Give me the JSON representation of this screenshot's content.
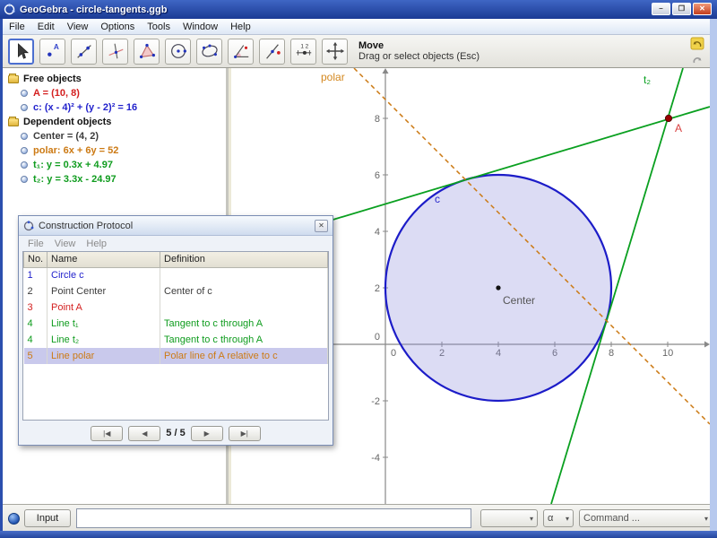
{
  "window": {
    "title": "GeoGebra - circle-tangents.ggb",
    "controls": {
      "minimize": "–",
      "maximize": "❐",
      "close": "✕"
    }
  },
  "menu": {
    "items": [
      "File",
      "Edit",
      "View",
      "Options",
      "Tools",
      "Window",
      "Help"
    ]
  },
  "toolbar": {
    "tools": [
      "move",
      "point",
      "line",
      "perpendicular-line",
      "polygon",
      "circle",
      "conic",
      "angle",
      "mirror",
      "slider",
      "move-graphics-view"
    ],
    "tooltip_title": "Move",
    "tooltip_subtitle": "Drag or select objects (Esc)"
  },
  "algebra": {
    "free_header": "Free objects",
    "dependent_header": "Dependent objects",
    "free": [
      {
        "label": "A = (10, 8)",
        "color": "#d42020"
      },
      {
        "label": "c: (x - 4)² + (y - 2)² = 16",
        "color": "#2222cc"
      }
    ],
    "dependent": [
      {
        "label": "Center = (4, 2)",
        "color": "#3c3c3c"
      },
      {
        "label": "polar: 6x + 6y = 52",
        "color": "#cc7a14"
      },
      {
        "label": "t₁: y = 0.3x + 4.97",
        "color": "#0f9c1e"
      },
      {
        "label": "t₂: y = 3.3x - 24.97",
        "color": "#0f9c1e"
      }
    ]
  },
  "protocol": {
    "title": "Construction Protocol",
    "close": "✕",
    "menu": [
      "File",
      "View",
      "Help"
    ],
    "columns": [
      "No.",
      "Name",
      "Definition"
    ],
    "rows": [
      {
        "no": "1",
        "name": "Circle c",
        "definition": "",
        "color": "#2222cc"
      },
      {
        "no": "2",
        "name": "Point Center",
        "definition": "Center of c",
        "color": "#3c3c3c"
      },
      {
        "no": "3",
        "name": "Point A",
        "definition": "",
        "color": "#d42020"
      },
      {
        "no": "4",
        "name": "Line t₁",
        "definition": "Tangent to c through A",
        "color": "#0f9c1e"
      },
      {
        "no": "4",
        "name": "Line t₂",
        "definition": "Tangent to c through A",
        "color": "#0f9c1e"
      },
      {
        "no": "5",
        "name": "Line polar",
        "definition": "Polar line of A relative to c",
        "color": "#cc7a14",
        "selected": true
      }
    ],
    "nav": {
      "first": "|◀",
      "prev": "◀",
      "position": "5 / 5",
      "next": "▶",
      "last": "▶|"
    }
  },
  "graph": {
    "x_ticks": [
      "0",
      "2",
      "4",
      "6",
      "8",
      "10"
    ],
    "y_ticks": [
      "8",
      "6",
      "4",
      "2",
      "0",
      "-2",
      "-4"
    ],
    "labels": {
      "polar": "polar",
      "t2": "t₂",
      "c": "c",
      "center": "Center",
      "a": "A"
    },
    "colors": {
      "circle": "#1c1cc8",
      "circle_fill": "#8c8cdc",
      "tangent": "#0aa020",
      "polar": "#cc7a14",
      "point_a": "#990000",
      "axis": "#888888"
    }
  },
  "inputbar": {
    "button": "Input",
    "value": "",
    "symbol_dropdown": "",
    "alpha_dropdown": "α",
    "command_dropdown": "Command ...",
    "caret": "▾"
  }
}
